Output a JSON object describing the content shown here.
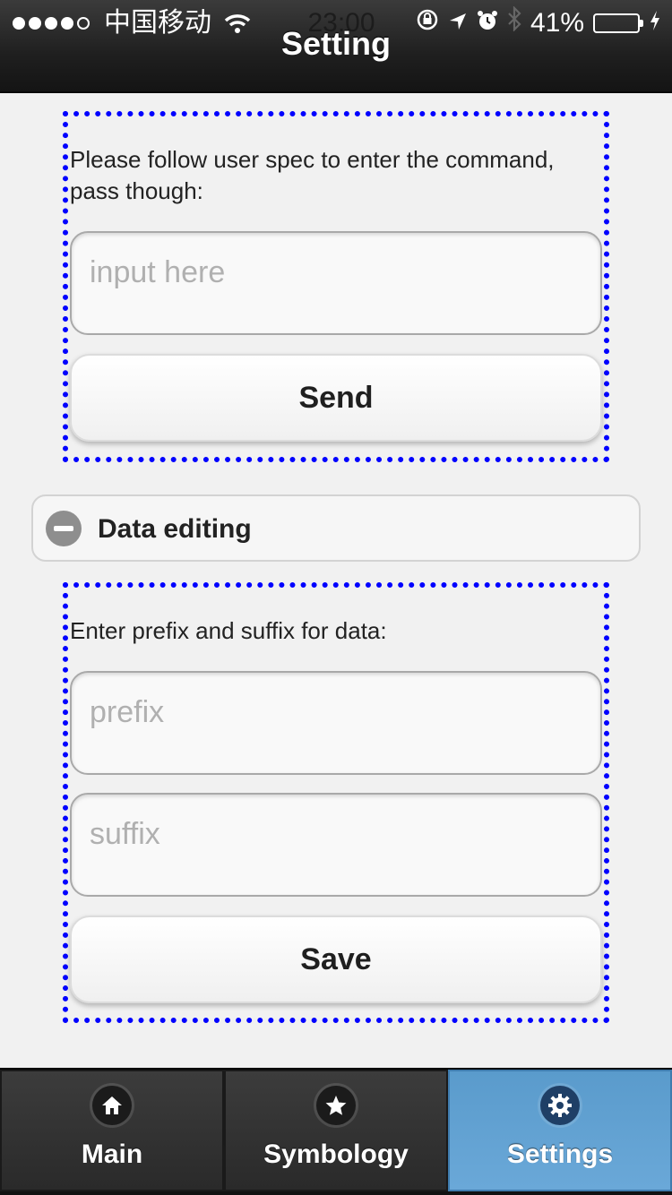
{
  "status_bar": {
    "carrier": "中国移动",
    "time": "23:00",
    "battery": "41%",
    "battery_level": 0.41,
    "icons": [
      "signal-dots",
      "wifi-icon",
      "lock-rotation-icon",
      "location-icon",
      "alarm-icon",
      "bluetooth-icon",
      "battery-icon",
      "charging-icon"
    ]
  },
  "header": {
    "title": "Setting"
  },
  "command_section": {
    "instruction": "Please follow user spec to enter the command, pass though:",
    "input_placeholder": "input here",
    "send_label": "Send"
  },
  "collapsible": {
    "label": "Data editing",
    "icon": "minus-icon"
  },
  "data_section": {
    "instruction": "Enter prefix and suffix for data:",
    "prefix_placeholder": "prefix",
    "suffix_placeholder": "suffix",
    "save_label": "Save"
  },
  "tabbar": {
    "tabs": [
      {
        "label": "Main",
        "icon": "home-icon",
        "active": false
      },
      {
        "label": "Symbology",
        "icon": "star-icon",
        "active": false
      },
      {
        "label": "Settings",
        "icon": "gear-icon",
        "active": true
      }
    ]
  },
  "colors": {
    "accent_active_tab": "#5a9bcc",
    "dotted_border": "#0000ff",
    "header_bg": "#1f1f1f",
    "page_bg": "#f1f1f1"
  }
}
